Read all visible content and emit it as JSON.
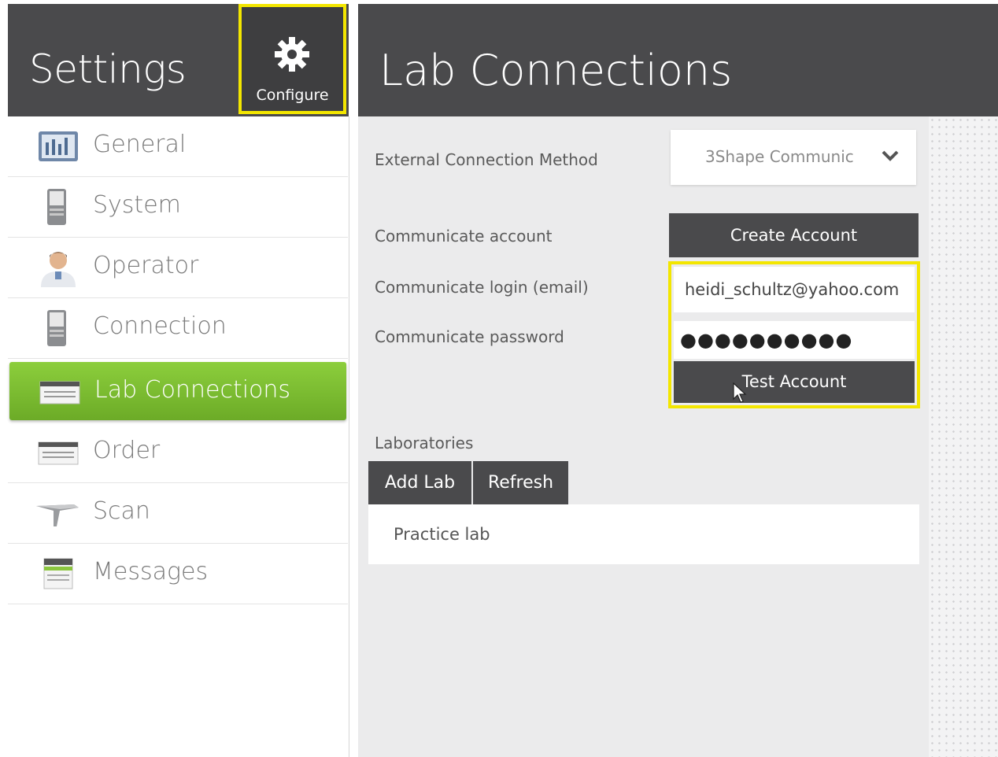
{
  "sidebar": {
    "title": "Settings",
    "configure_label": "Configure",
    "items": [
      {
        "label": "General",
        "icon": "general-settings-icon"
      },
      {
        "label": "System",
        "icon": "system-device-icon"
      },
      {
        "label": "Operator",
        "icon": "operator-avatar-icon"
      },
      {
        "label": "Connection",
        "icon": "connection-device-icon"
      },
      {
        "label": "Lab Connections",
        "icon": "lab-connections-icon",
        "active": true
      },
      {
        "label": "Order",
        "icon": "order-icon"
      },
      {
        "label": "Scan",
        "icon": "scanner-icon"
      },
      {
        "label": "Messages",
        "icon": "messages-icon"
      }
    ]
  },
  "main": {
    "title": "Lab Connections",
    "external_method": {
      "label": "External Connection Method",
      "value": "3Shape Communic"
    },
    "account": {
      "label": "Communicate account",
      "create_label": "Create Account"
    },
    "login": {
      "label": "Communicate login (email)",
      "value": "heidi_schultz@yahoo.com"
    },
    "password": {
      "label": "Communicate password",
      "value": "●●●●●●●●●●"
    },
    "test_label": "Test Account",
    "laboratories": {
      "label": "Laboratories",
      "add_label": "Add Lab",
      "refresh_label": "Refresh",
      "rows": [
        "Practice lab"
      ]
    }
  },
  "colors": {
    "header_bg": "#4a4a4c",
    "accent_green": "#7dbf31",
    "highlight_yellow": "#f3e600",
    "content_bg": "#ebebec"
  }
}
